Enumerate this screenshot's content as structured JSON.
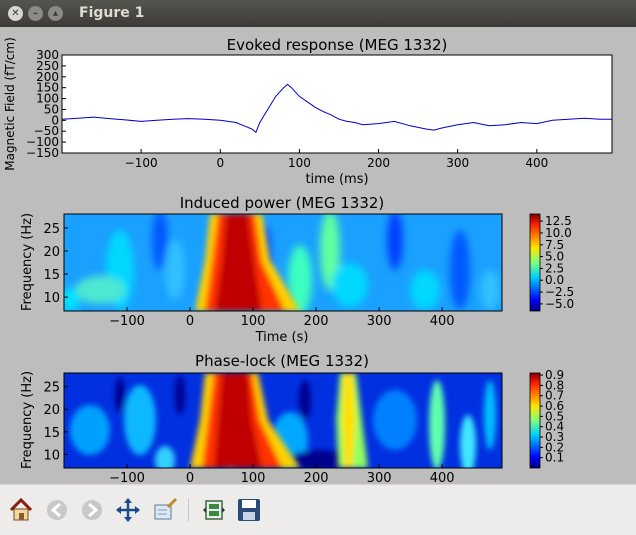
{
  "window": {
    "title": "Figure 1"
  },
  "toolbar": {
    "buttons": [
      {
        "name": "home",
        "icon": "home-icon"
      },
      {
        "name": "back",
        "icon": "back-arrow-icon"
      },
      {
        "name": "forward",
        "icon": "forward-arrow-icon"
      },
      {
        "name": "pan",
        "icon": "pan-arrows-icon"
      },
      {
        "name": "zoom",
        "icon": "zoom-rect-icon"
      },
      {
        "name": "configure",
        "icon": "subplots-icon"
      },
      {
        "name": "save",
        "icon": "save-icon"
      }
    ]
  },
  "chart_data": [
    {
      "type": "line",
      "title": "Evoked response (MEG 1332)",
      "xlabel": "time (ms)",
      "ylabel": "Magnetic Field (fT/cm)",
      "xlim": [
        -200,
        495
      ],
      "ylim": [
        -150,
        300
      ],
      "xticks": [
        "−100",
        "0",
        "100",
        "200",
        "300",
        "400"
      ],
      "yticks": [
        "300",
        "250",
        "200",
        "150",
        "100",
        "50",
        "0",
        "−50",
        "−100",
        "−150"
      ],
      "line_color": "#0000cc",
      "series": [
        {
          "x": [
            -200,
            -180,
            -160,
            -140,
            -120,
            -100,
            -80,
            -60,
            -40,
            -20,
            0,
            20,
            30,
            40,
            45,
            50,
            60,
            70,
            80,
            85,
            90,
            100,
            110,
            120,
            130,
            140,
            150,
            160,
            170,
            180,
            200,
            220,
            240,
            260,
            270,
            280,
            300,
            320,
            340,
            360,
            380,
            400,
            420,
            440,
            460,
            480,
            495
          ],
          "y": [
            5,
            10,
            15,
            8,
            2,
            -5,
            0,
            5,
            8,
            5,
            0,
            -10,
            -25,
            -40,
            -55,
            -10,
            50,
            110,
            150,
            165,
            150,
            110,
            85,
            60,
            40,
            25,
            5,
            -5,
            -10,
            -20,
            -15,
            -5,
            -25,
            -40,
            -45,
            -35,
            -20,
            -10,
            -25,
            -20,
            -10,
            -15,
            0,
            5,
            10,
            5,
            5
          ]
        }
      ]
    },
    {
      "type": "heatmap",
      "title": "Induced power (MEG 1332)",
      "xlabel": "Time (s)",
      "ylabel": "Frequency (Hz)",
      "xlim": [
        -200,
        495
      ],
      "ylim": [
        7,
        28
      ],
      "xticks": [
        "−100",
        "0",
        "100",
        "200",
        "300",
        "400"
      ],
      "yticks": [
        "25",
        "20",
        "15",
        "10"
      ],
      "colorbar_ticks": [
        "12.5",
        "10.0",
        "7.5",
        "5.0",
        "2.5",
        "0.0",
        "−2.5",
        "−5.0"
      ],
      "colorbar_range": [
        -6.5,
        14
      ]
    },
    {
      "type": "heatmap",
      "title": "Phase-lock (MEG 1332)",
      "xlabel": "",
      "ylabel": "Frequency (Hz)",
      "xlim": [
        -200,
        495
      ],
      "ylim": [
        7,
        28
      ],
      "xticks": [
        "−100",
        "0",
        "100",
        "200",
        "300",
        "400"
      ],
      "yticks": [
        "25",
        "20",
        "15",
        "10"
      ],
      "colorbar_ticks": [
        "0.9",
        "0.8",
        "0.7",
        "0.6",
        "0.5",
        "0.4",
        "0.3",
        "0.2",
        "0.1"
      ],
      "colorbar_range": [
        0.0,
        0.92
      ]
    }
  ]
}
